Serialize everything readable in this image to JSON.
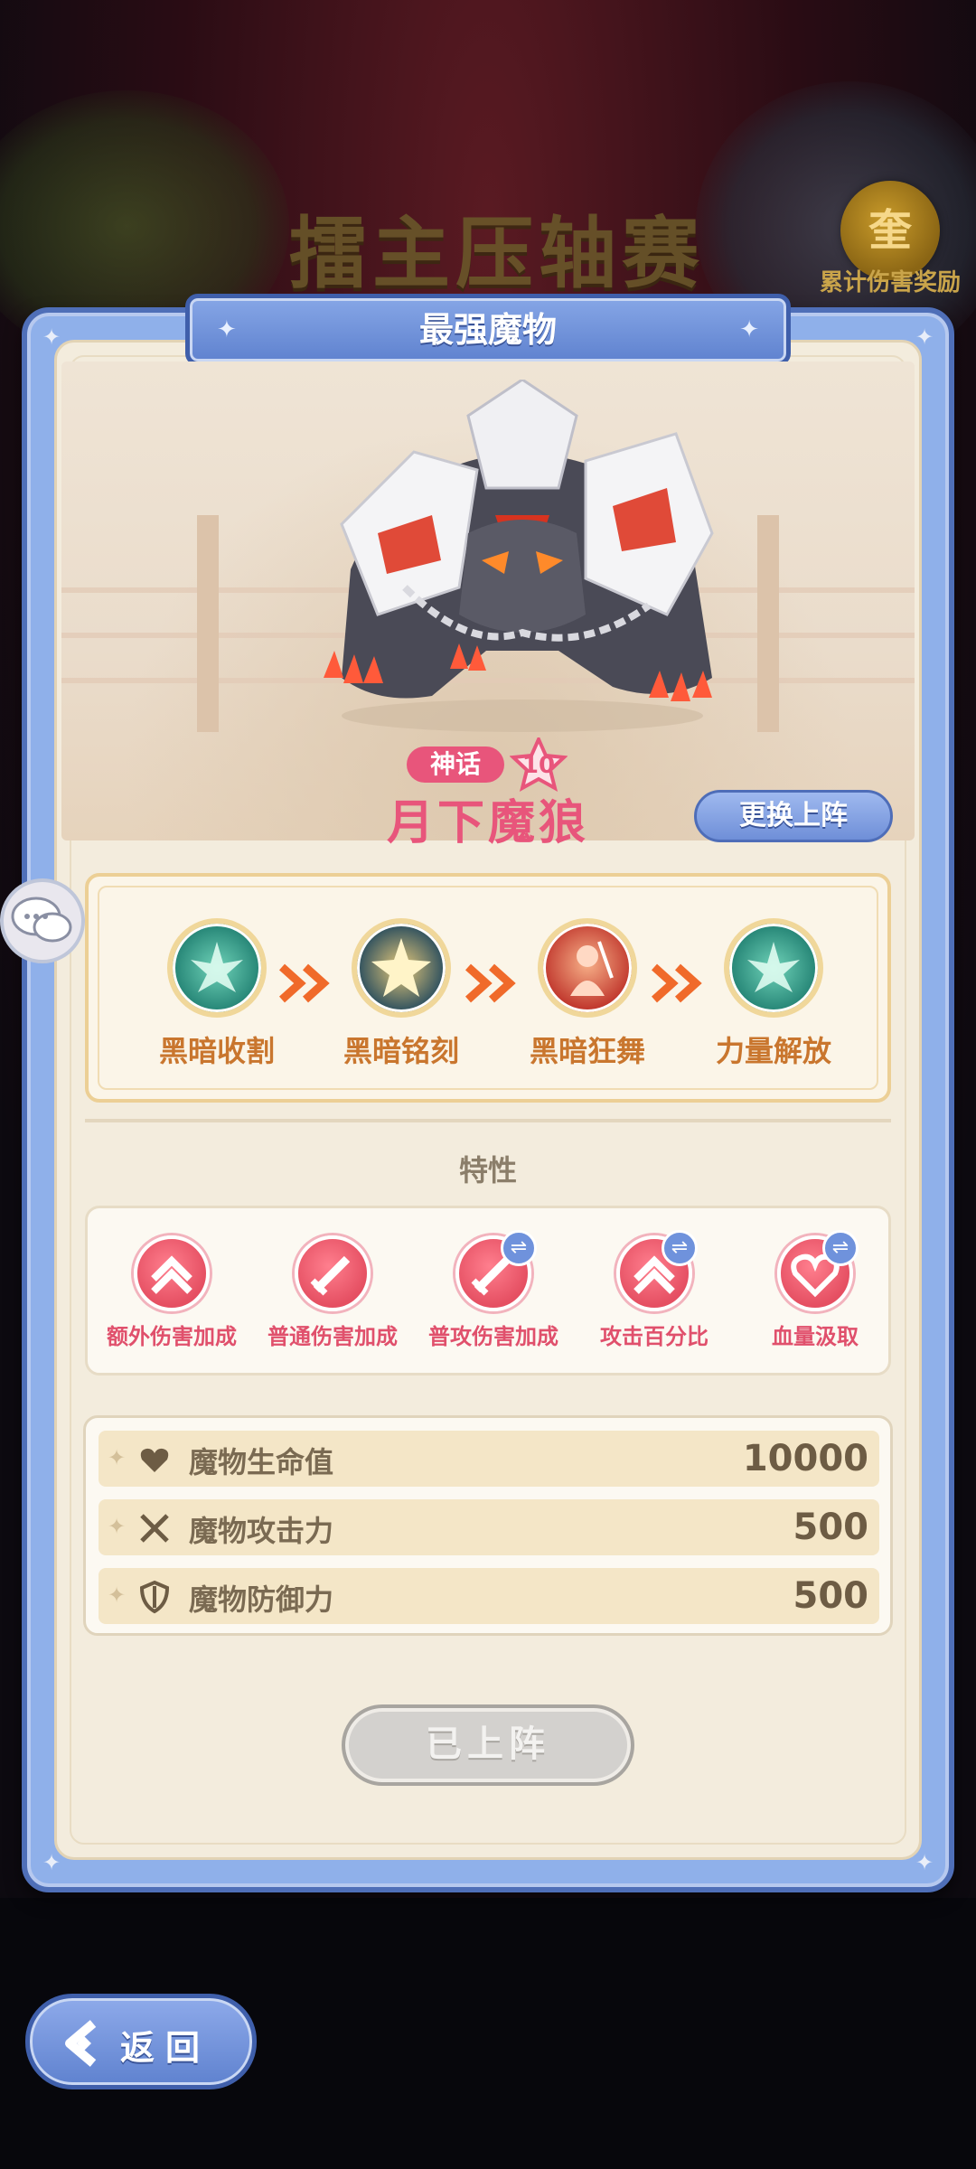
{
  "background": {
    "event_title": "擂主压轴赛",
    "reward_badge_glyph": "奎",
    "reward_label": "累计伤害奖励"
  },
  "panel": {
    "title": "最强魔物"
  },
  "monster": {
    "rarity": "神话",
    "level": "10",
    "name": "月下魔狼",
    "swap_button": "更换上阵"
  },
  "skills": [
    {
      "label": "黑暗收割",
      "icon": "green-burst-icon",
      "color": "#2f9f8a"
    },
    {
      "label": "黑暗铭刻",
      "icon": "gold-star-icon",
      "color": "#2c4f5e"
    },
    {
      "label": "黑暗狂舞",
      "icon": "red-warrior-icon",
      "color": "#c0362c"
    },
    {
      "label": "力量解放",
      "icon": "green-burst-icon",
      "color": "#2f9f8a"
    }
  ],
  "traits_title": "特性",
  "traits": [
    {
      "label": "额外伤害加成",
      "icon": "chevron-up-icon",
      "swappable": false
    },
    {
      "label": "普通伤害加成",
      "icon": "sword-icon",
      "swappable": false
    },
    {
      "label": "普攻伤害加成",
      "icon": "sword-icon",
      "swappable": true
    },
    {
      "label": "攻击百分比",
      "icon": "chevron-up-icon",
      "swappable": true
    },
    {
      "label": "血量汲取",
      "icon": "heart-icon",
      "swappable": true
    }
  ],
  "stats": [
    {
      "label": "魔物生命值",
      "value": "10000",
      "icon": "heart-icon"
    },
    {
      "label": "魔物攻击力",
      "value": "500",
      "icon": "crossed-swords-icon"
    },
    {
      "label": "魔物防御力",
      "value": "500",
      "icon": "shield-icon"
    }
  ],
  "deployed_button": "已上阵",
  "back_button": "返回"
}
